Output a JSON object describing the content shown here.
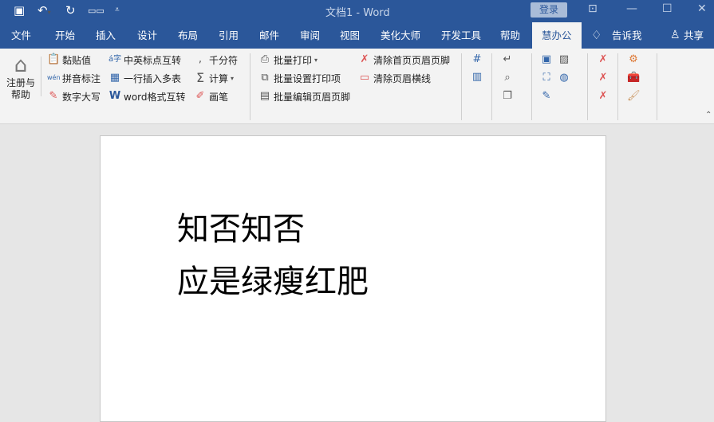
{
  "titlebar": {
    "title": "文档1  -  Word",
    "login": "登录",
    "quick_access": [
      "save-icon",
      "undo-icon",
      "redo-icon",
      "touch-mode-icon",
      "customize-icon"
    ]
  },
  "tabs": [
    "文件",
    "开始",
    "插入",
    "设计",
    "布局",
    "引用",
    "邮件",
    "审阅",
    "视图",
    "美化大师",
    "开发工具",
    "帮助",
    "慧办公"
  ],
  "active_tab": "慧办公",
  "tell_me": "告诉我",
  "share": "共享",
  "ribbon": {
    "register_help": "注册与帮助",
    "col1": [
      "黏贴值",
      "拼音标注",
      "数字大写"
    ],
    "col2": [
      "中英标点互转",
      "一行插入多表",
      "word格式互转"
    ],
    "col3": [
      "千分符",
      "计算",
      "画笔"
    ],
    "col4": [
      "批量打印",
      "批量设置打印项",
      "批量编辑页眉页脚"
    ],
    "col5": [
      "清除首页页眉页脚",
      "清除页眉横线"
    ]
  },
  "document": {
    "lines": [
      "知否知否",
      "应是绿瘦红肥"
    ]
  }
}
